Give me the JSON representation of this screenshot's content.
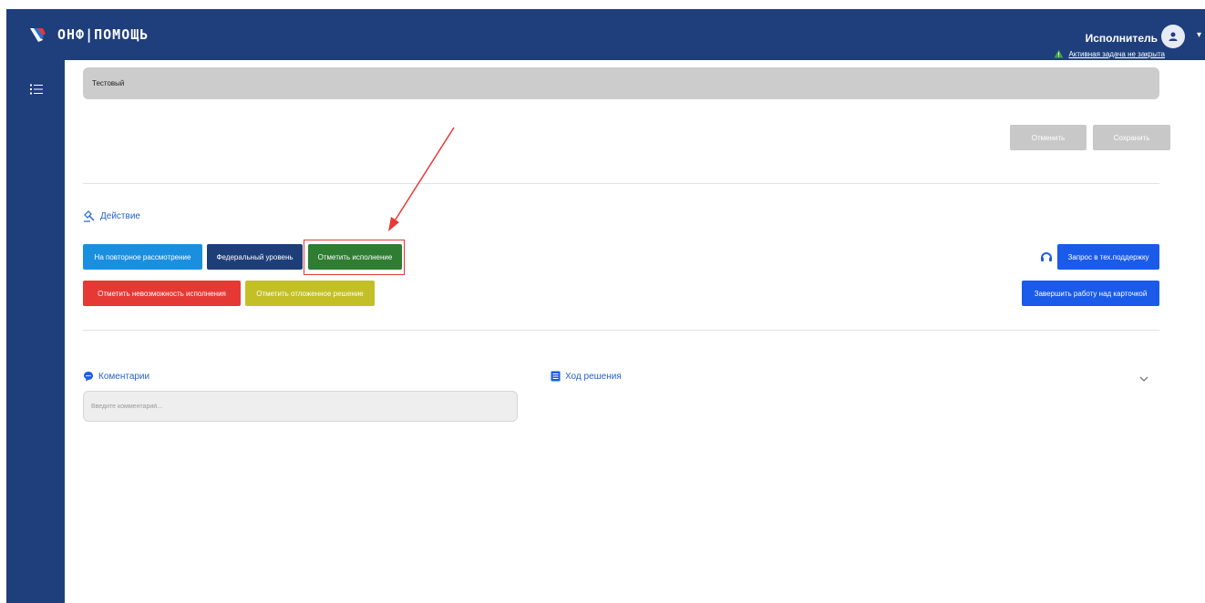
{
  "header": {
    "logo_text": "ОНФ|ПОМОЩЬ",
    "user_role": "Исполнитель",
    "task_warning": "Активная задача не закрыта"
  },
  "form": {
    "name_value": "Тестовый",
    "cancel_label": "Отменить",
    "save_label": "Сохранить"
  },
  "actions": {
    "title": "Действие",
    "buttons": [
      "На повторное рассмотрение",
      "Федеральный уровень",
      "Отметить исполнение",
      "Отметить невозможность исполнения",
      "Отметить отложенное решение"
    ],
    "support_label": "Запрос в тех.поддержку",
    "finish_label": "Завершить работу над карточкой"
  },
  "comments": {
    "title": "Коментарии",
    "placeholder": "Введите комментарий..."
  },
  "progress": {
    "title": "Ход решения"
  },
  "colors": {
    "header_bg": "#1f3e7c",
    "blue": "#1a8fe0",
    "navy": "#1e3e7a",
    "green": "#2f7d32",
    "red": "#e53935",
    "olive": "#c2c026",
    "bright_blue": "#1a5bea",
    "link": "#2563c9"
  },
  "icons": {
    "logo": "onf-logo-icon",
    "menu": "list-menu-icon",
    "avatar": "user-avatar-icon",
    "warning": "warning-triangle-icon",
    "action": "gavel-icon",
    "support": "headset-icon",
    "comments": "chat-bubble-icon",
    "progress": "document-icon",
    "chevron": "chevron-down-icon"
  }
}
